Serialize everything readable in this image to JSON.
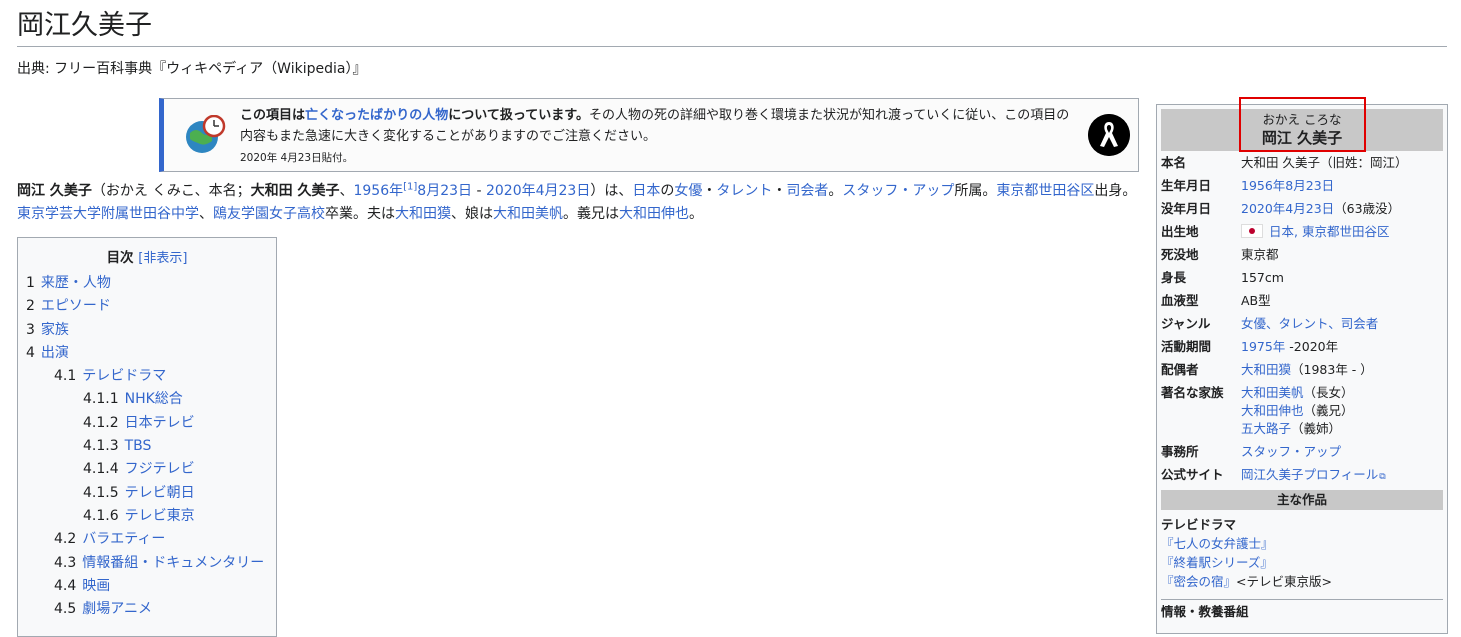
{
  "title": "岡江久美子",
  "tagline": "出典: フリー百科事典『ウィキペディア（Wikipedia）』",
  "notice": {
    "bold_prefix": "この項目は",
    "link": "亡くなったばかりの人物",
    "bold_suffix": "について扱っています。",
    "rest": "その人物の死の詳細や取り巻く環境また状況が知れ渡っていくに従い、この項目の内容もまた急速に大きく変化することがありますのでご注意ください。",
    "date": "2020年 4月23日貼付。"
  },
  "lead": {
    "name": "岡江 久美子",
    "p1": "（おかえ くみこ、本名；",
    "real_name": "大和田 久美子",
    "p2": "、",
    "birth_year": "1956年",
    "ref": "[1]",
    "birth_day": "8月23日",
    "dash": " - ",
    "death": "2020年4月23日",
    "p3": "）は、",
    "l_japan": "日本",
    "p4": "の",
    "l_actress": "女優",
    "p5": "・",
    "l_talent": "タレント",
    "p6": "・",
    "l_host": "司会者",
    "p7": "。",
    "l_agency": "スタッフ・アップ",
    "p8": "所属。",
    "l_setagaya": "東京都世田谷区",
    "p9": "出身。",
    "l_school1": "東京学芸大学附属世田谷中学",
    "p10": "、",
    "l_school2": "鴎友学園女子高校",
    "p11": "卒業。夫は",
    "l_husband": "大和田獏",
    "p12": "、娘は",
    "l_daughter": "大和田美帆",
    "p13": "。義兄は",
    "l_brother": "大和田伸也",
    "p14": "。"
  },
  "toc": {
    "title": "目次",
    "toggle": "[非表示]",
    "items": [
      {
        "num": "1",
        "label": "来歴・人物",
        "level": 1
      },
      {
        "num": "2",
        "label": "エピソード",
        "level": 1
      },
      {
        "num": "3",
        "label": "家族",
        "level": 1
      },
      {
        "num": "4",
        "label": "出演",
        "level": 1
      },
      {
        "num": "4.1",
        "label": "テレビドラマ",
        "level": 2
      },
      {
        "num": "4.1.1",
        "label": "NHK総合",
        "level": 3
      },
      {
        "num": "4.1.2",
        "label": "日本テレビ",
        "level": 3
      },
      {
        "num": "4.1.3",
        "label": "TBS",
        "level": 3
      },
      {
        "num": "4.1.4",
        "label": "フジテレビ",
        "level": 3
      },
      {
        "num": "4.1.5",
        "label": "テレビ朝日",
        "level": 3
      },
      {
        "num": "4.1.6",
        "label": "テレビ東京",
        "level": 3
      },
      {
        "num": "4.2",
        "label": "バラエティー",
        "level": 2
      },
      {
        "num": "4.3",
        "label": "情報番組・ドキュメンタリー",
        "level": 2
      },
      {
        "num": "4.4",
        "label": "映画",
        "level": 2
      },
      {
        "num": "4.5",
        "label": "劇場アニメ",
        "level": 2
      }
    ]
  },
  "infobox": {
    "reading": "おかえ ころな",
    "name": "岡江 久美子",
    "rows": [
      {
        "label": "本名",
        "value": "大和田 久美子（旧姓：岡江）",
        "link": false
      },
      {
        "label": "生年月日",
        "value": "1956年8月23日",
        "link": true
      },
      {
        "label": "没年月日",
        "value": "2020年4月23日",
        "suffix": "（63歳没）",
        "link": true
      },
      {
        "label": "出生地",
        "value": "日本, 東京都世田谷区",
        "link": true,
        "flag": true
      },
      {
        "label": "死没地",
        "value": "東京都",
        "link": false
      },
      {
        "label": "身長",
        "value": "157cm",
        "link": false
      },
      {
        "label": "血液型",
        "value": "AB型",
        "link": false
      },
      {
        "label": "ジャンル",
        "value": "女優、タレント、司会者",
        "link": true
      },
      {
        "label": "活動期間",
        "value": "1975年",
        "suffix": " -2020年",
        "link": true
      },
      {
        "label": "配偶者",
        "value": "大和田獏",
        "suffix": "（1983年 - ）",
        "link": true
      },
      {
        "label": "著名な家族",
        "lines": [
          {
            "value": "大和田美帆",
            "suffix": "（長女）"
          },
          {
            "value": "大和田伸也",
            "suffix": "（義兄）"
          },
          {
            "value": "五大路子",
            "suffix": "（義姉）"
          }
        ]
      },
      {
        "label": "事務所",
        "value": "スタッフ・アップ",
        "link": true
      },
      {
        "label": "公式サイト",
        "value": "岡江久美子プロフィール",
        "link": true,
        "external": true
      }
    ],
    "works_title": "主な作品",
    "drama_head": "テレビドラマ",
    "dramas": [
      {
        "title": "『七人の女弁護士』",
        "suffix": ""
      },
      {
        "title": "『終着駅シリーズ』",
        "suffix": ""
      },
      {
        "title": "『密会の宿』",
        "suffix": "<テレビ東京版>"
      }
    ],
    "info_head": "情報・教養番組"
  },
  "colors": {
    "link": "#3366cc",
    "highlight": "#e00000",
    "notice_border": "#3366cc"
  }
}
